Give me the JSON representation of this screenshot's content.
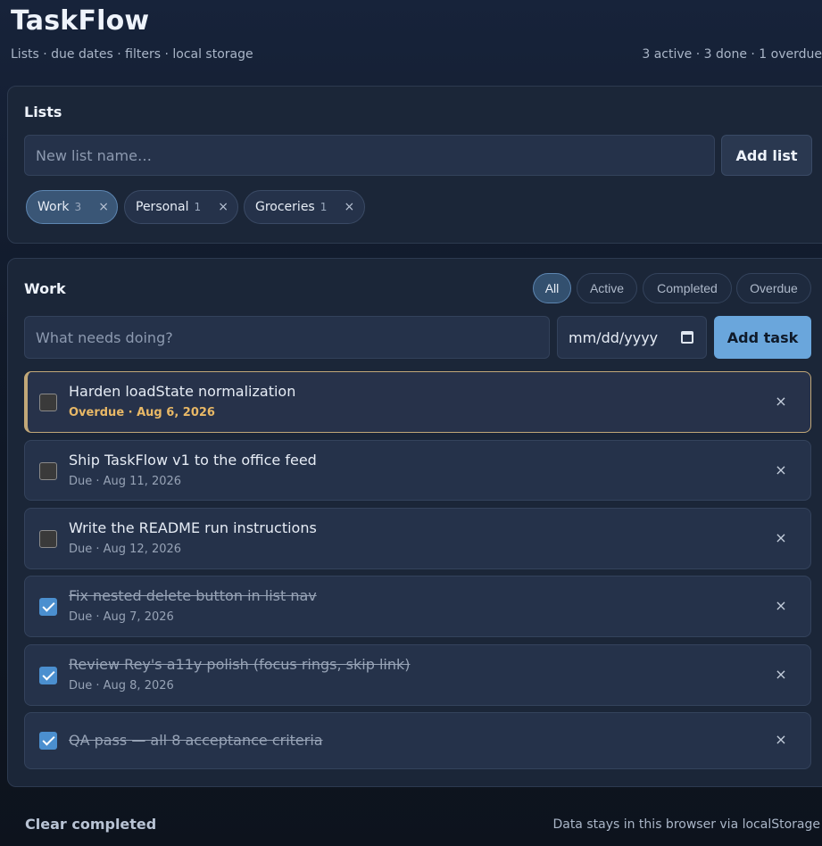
{
  "header": {
    "title": "TaskFlow",
    "subtitle": "Lists · due dates · filters · local storage",
    "stats": "3 active · 3 done · 1 overdue"
  },
  "lists_panel": {
    "title": "Lists",
    "new_list_placeholder": "New list name…",
    "add_list_label": "Add list",
    "lists": [
      {
        "name": "Work",
        "count": "3",
        "active": true
      },
      {
        "name": "Personal",
        "count": "1",
        "active": false
      },
      {
        "name": "Groceries",
        "count": "1",
        "active": false
      }
    ],
    "remove_glyph": "×"
  },
  "tasks_panel": {
    "title": "Work",
    "filters": [
      {
        "label": "All",
        "active": true
      },
      {
        "label": "Active",
        "active": false
      },
      {
        "label": "Completed",
        "active": false
      },
      {
        "label": "Overdue",
        "active": false
      }
    ],
    "task_placeholder": "What needs doing?",
    "date_placeholder": "mm/dd/yyyy",
    "add_task_label": "Add task",
    "delete_glyph": "×",
    "tasks": [
      {
        "title": "Harden loadState normalization",
        "meta": "Overdue · Aug 6, 2026",
        "done": false,
        "overdue": true
      },
      {
        "title": "Ship TaskFlow v1 to the office feed",
        "meta": "Due · Aug 11, 2026",
        "done": false,
        "overdue": false
      },
      {
        "title": "Write the README run instructions",
        "meta": "Due · Aug 12, 2026",
        "done": false,
        "overdue": false
      },
      {
        "title": "Fix nested delete button in list nav",
        "meta": "Due · Aug 7, 2026",
        "done": true,
        "overdue": false
      },
      {
        "title": "Review Rey's a11y polish (focus rings, skip link)",
        "meta": "Due · Aug 8, 2026",
        "done": true,
        "overdue": false
      },
      {
        "title": "QA pass — all 8 acceptance criteria",
        "meta": "",
        "done": true,
        "overdue": false
      }
    ]
  },
  "footer": {
    "clear_completed_label": "Clear completed",
    "note": "Data stays in this browser via localStorage"
  },
  "colors": {
    "accent": "#6aa6dc",
    "overdue": "#e8b866",
    "background": "#111a2a",
    "panel": "#1b2638"
  },
  "icons": {
    "date_picker": "calendar-icon",
    "remove": "close-icon",
    "checkbox_checked": "checkmark-icon"
  }
}
